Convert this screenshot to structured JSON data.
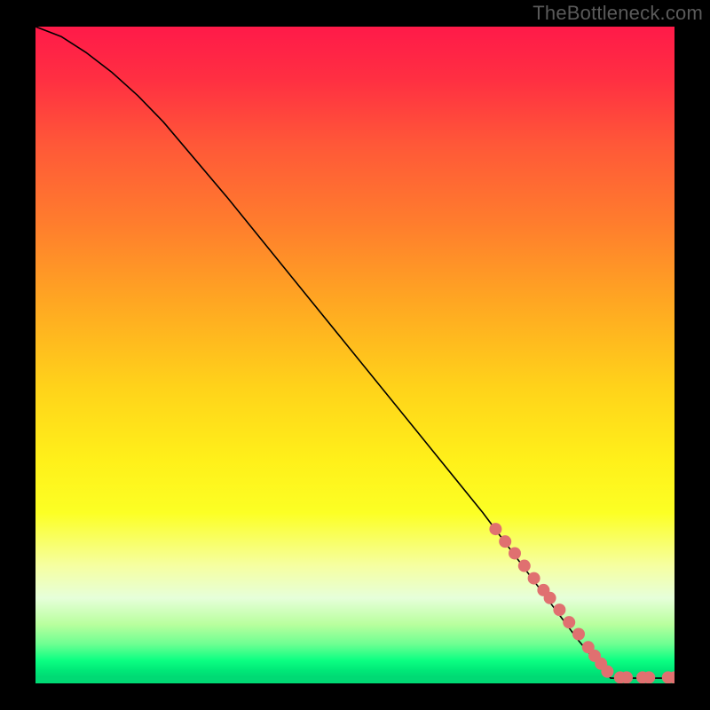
{
  "watermark": "TheBottleneck.com",
  "colors": {
    "gradient_top": "#ff1a49",
    "gradient_mid": "#ffd31a",
    "gradient_bottom": "#00da74",
    "curve": "#000000",
    "marker": "#e07070",
    "background": "#000000",
    "watermark_text": "#5a5a5a"
  },
  "chart_data": {
    "type": "line",
    "title": "",
    "xlabel": "",
    "ylabel": "",
    "xlim": [
      0,
      100
    ],
    "ylim": [
      0,
      100
    ],
    "curve": {
      "x": [
        0,
        4,
        8,
        12,
        16,
        20,
        30,
        40,
        50,
        60,
        70,
        80,
        85,
        88,
        90,
        100
      ],
      "y": [
        100,
        98.5,
        96,
        93,
        89.5,
        85.5,
        74,
        62,
        50,
        38,
        26,
        13,
        6.5,
        3,
        0.8,
        0.8
      ]
    },
    "series": [
      {
        "name": "markers",
        "x": [
          72,
          73.5,
          75,
          76.5,
          78,
          79.5,
          80.5,
          82,
          83.5,
          85,
          86.5,
          87.5,
          88.5,
          89.5,
          91.5,
          92.5,
          95,
          96,
          99,
          100
        ],
        "y": [
          23.5,
          21.6,
          19.8,
          17.9,
          16.0,
          14.2,
          13.0,
          11.2,
          9.3,
          7.5,
          5.5,
          4.2,
          3.0,
          1.8,
          0.9,
          0.9,
          0.9,
          0.9,
          0.9,
          0.9
        ]
      }
    ],
    "grid": false,
    "legend": false
  }
}
